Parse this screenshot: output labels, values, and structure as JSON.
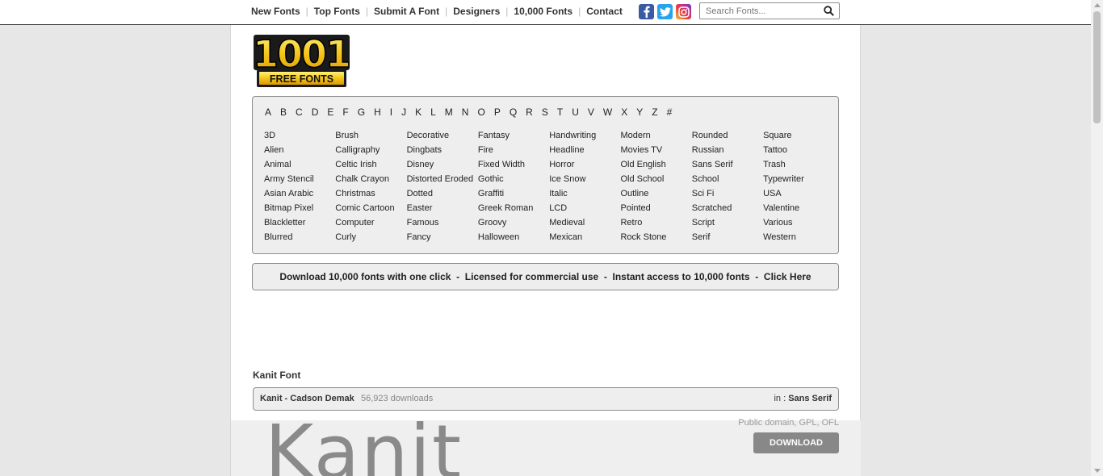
{
  "nav": {
    "items": [
      "New Fonts",
      "Top Fonts",
      "Submit A Font",
      "Designers",
      "10,000 Fonts",
      "Contact"
    ]
  },
  "social": {
    "facebook": "f",
    "twitter": "t",
    "instagram": "ig"
  },
  "search": {
    "placeholder": "Search Fonts..."
  },
  "logo": {
    "text_top": "1001",
    "text_bottom": "FREE FONTS"
  },
  "alphabet": [
    "A",
    "B",
    "C",
    "D",
    "E",
    "F",
    "G",
    "H",
    "I",
    "J",
    "K",
    "L",
    "M",
    "N",
    "O",
    "P",
    "Q",
    "R",
    "S",
    "T",
    "U",
    "V",
    "W",
    "X",
    "Y",
    "Z",
    "#"
  ],
  "categories": [
    [
      "3D",
      "Alien",
      "Animal",
      "Army Stencil",
      "Asian Arabic",
      "Bitmap Pixel",
      "Blackletter",
      "Blurred"
    ],
    [
      "Brush",
      "Calligraphy",
      "Celtic Irish",
      "Chalk Crayon",
      "Christmas",
      "Comic Cartoon",
      "Computer",
      "Curly"
    ],
    [
      "Decorative",
      "Dingbats",
      "Disney",
      "Distorted Eroded",
      "Dotted",
      "Easter",
      "Famous",
      "Fancy"
    ],
    [
      "Fantasy",
      "Fire",
      "Fixed Width",
      "Gothic",
      "Graffiti",
      "Greek Roman",
      "Groovy",
      "Halloween"
    ],
    [
      "Handwriting",
      "Headline",
      "Horror",
      "Ice Snow",
      "Italic",
      "LCD",
      "Medieval",
      "Mexican"
    ],
    [
      "Modern",
      "Movies TV",
      "Old English",
      "Old School",
      "Outline",
      "Pointed",
      "Retro",
      "Rock Stone"
    ],
    [
      "Rounded",
      "Russian",
      "Sans Serif",
      "School",
      "Sci Fi",
      "Scratched",
      "Script",
      "Serif"
    ],
    [
      "Square",
      "Tattoo",
      "Trash",
      "Typewriter",
      "USA",
      "Valentine",
      "Various",
      "Western"
    ]
  ],
  "promo": {
    "text": "Download 10,000 fonts with one click  -  Licensed for commercial use  -  Instant access to 10,000 fonts  -  Click Here"
  },
  "font": {
    "title": "Kanit Font",
    "name": "Kanit - Cadson Demak",
    "downloads": "56,923 downloads",
    "category_prefix": "in : ",
    "category": "Sans Serif",
    "license": "Public domain, GPL, OFL",
    "download_label": "DOWNLOAD",
    "preview_text": "Kanit"
  },
  "colors": {
    "facebook": "#3b5aa4",
    "twitter": "#2aa3ef",
    "download_button": "#888888",
    "box_bg": "#eeeeee"
  }
}
